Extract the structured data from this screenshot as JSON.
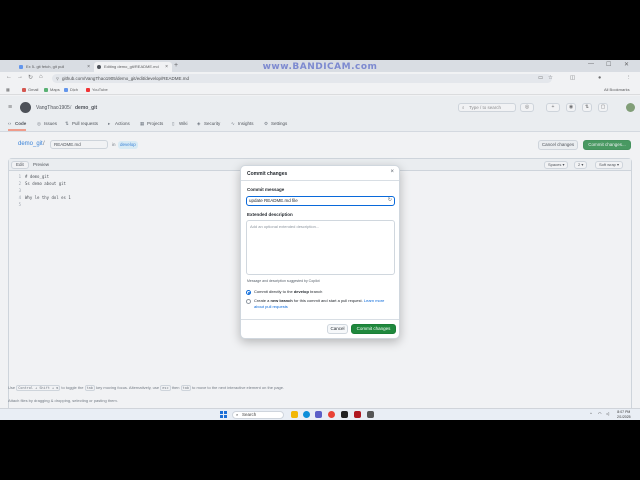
{
  "watermark": "www.BANDICAM.com",
  "browser": {
    "tabs": [
      {
        "label": "Ex 5- git fetch, git pull",
        "icon": "document-icon"
      },
      {
        "label": "Editing demo_git/README.md",
        "icon": "github-icon"
      }
    ],
    "new_tab": "+",
    "controls": {
      "minimize": "—",
      "maximize": "☐",
      "close": "✕"
    },
    "url": "github.com/VangThao1905/demo_git/edit/develop/README.md",
    "bookmarks": [
      {
        "label": "Gmail",
        "color": "#d93025"
      },
      {
        "label": "Maps",
        "color": "#34a853"
      },
      {
        "label": "Dịch",
        "color": "#4285f4"
      },
      {
        "label": "YouTube",
        "color": "#ff0000"
      }
    ],
    "all_bookmarks": "All Bookmarks"
  },
  "github": {
    "owner": "VangThao1905",
    "repo": "demo_git",
    "search_placeholder": "Type / to search",
    "tabs": [
      "Code",
      "Issues",
      "Pull requests",
      "Actions",
      "Projects",
      "Wiki",
      "Security",
      "Insights",
      "Settings"
    ],
    "selected_tab": "Code"
  },
  "editor": {
    "repo_link": "demo_git",
    "separator": "/",
    "filename": "README.md",
    "in_label": "in",
    "branch": "develop",
    "cancel_label": "Cancel changes",
    "commit_label": "Commit changes...",
    "edit_tab": "Edit",
    "preview_tab": "Preview",
    "indent_mode": "Spaces",
    "indent_size": "2",
    "wrap_mode": "Soft wrap",
    "lines": [
      {
        "n": "1",
        "text": "# demo_git"
      },
      {
        "n": "2",
        "text": "Ss demo about git"
      },
      {
        "n": "3",
        "text": ""
      },
      {
        "n": "4",
        "text": "Why le thy dol es 1"
      },
      {
        "n": "5",
        "text": ""
      }
    ],
    "hint_parts": [
      "Use",
      "Control + Shift + m",
      "to toggle the",
      "tab",
      "key moving focus. Alternatively, use",
      "esc",
      "then",
      "tab",
      "to move to the next interactive element on the page."
    ],
    "attach_hint": "Attach files by dragging & dropping, selecting or pasting them."
  },
  "dialog": {
    "title": "Commit changes",
    "close": "×",
    "message_label": "Commit message",
    "message_value": "update README.md file",
    "extended_label": "Extended description",
    "extended_placeholder": "Add an optional extended description...",
    "suggest_note": "Message and description suggested by Copilot",
    "option1_pre": "Commit directly to the",
    "option1_branch": "develop",
    "option1_post": "branch",
    "option2_pre": "Create a",
    "option2_bold": "new branch",
    "option2_post": "for this commit and start a pull request.",
    "option2_link": "Learn more about pull requests",
    "cancel": "Cancel",
    "commit": "Commit changes",
    "selected_option": "direct"
  },
  "taskbar": {
    "search": "Search",
    "time": "8:07 PM",
    "date": "2/1/2025",
    "apps": [
      {
        "name": "file-explorer-icon",
        "color": "#f2b705"
      },
      {
        "name": "edge-icon",
        "color": "#0c8ed9"
      },
      {
        "name": "store-icon",
        "color": "#5b5fc7"
      },
      {
        "name": "chrome-icon",
        "color": "#e94235"
      },
      {
        "name": "terminal-icon",
        "color": "#222222"
      },
      {
        "name": "bandicam-icon",
        "color": "#b01820"
      },
      {
        "name": "notes-icon",
        "color": "#555555"
      }
    ]
  }
}
